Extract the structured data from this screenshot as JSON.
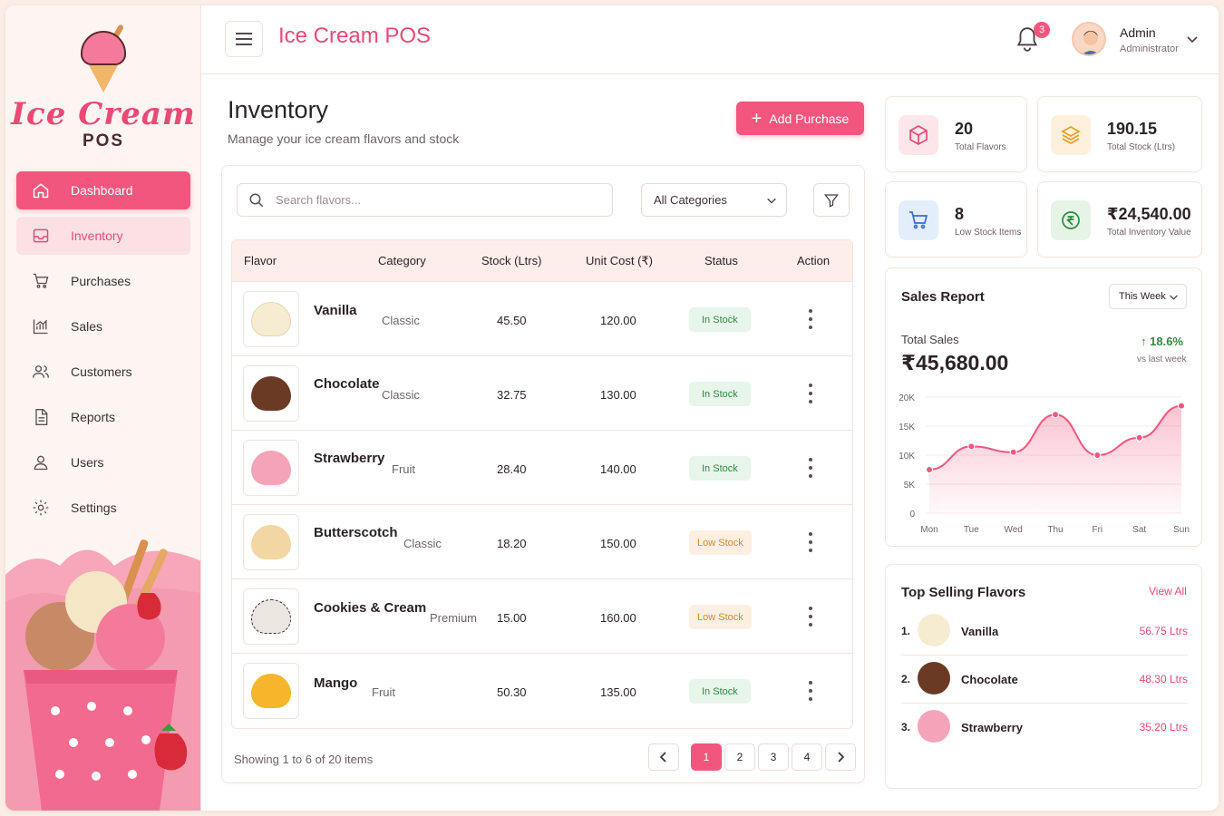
{
  "sidebar": {
    "logo_title": "Ice Cream",
    "logo_sub": "POS",
    "items": [
      {
        "label": "Dashboard",
        "icon": "home-icon"
      },
      {
        "label": "Inventory",
        "icon": "inbox-icon"
      },
      {
        "label": "Purchases",
        "icon": "cart-icon"
      },
      {
        "label": "Sales",
        "icon": "chart-icon"
      },
      {
        "label": "Customers",
        "icon": "users-icon"
      },
      {
        "label": "Reports",
        "icon": "document-icon"
      },
      {
        "label": "Users",
        "icon": "user-icon"
      },
      {
        "label": "Settings",
        "icon": "gear-icon"
      }
    ]
  },
  "header": {
    "title": "Ice Cream POS",
    "notifications": "3",
    "user_name": "Admin",
    "user_role": "Administrator"
  },
  "page": {
    "title": "Inventory",
    "subtitle": "Manage your ice cream flavors and stock",
    "add_button": "Add Purchase"
  },
  "filters": {
    "search_placeholder": "Search flavors...",
    "category": "All Categories"
  },
  "table": {
    "columns": [
      "Flavor",
      "Category",
      "Stock (Ltrs)",
      "Unit Cost (₹)",
      "Status",
      "Action"
    ],
    "rows": [
      {
        "flavor": "Vanilla",
        "category": "Classic",
        "stock": "45.50",
        "cost": "120.00",
        "status": "In Stock"
      },
      {
        "flavor": "Chocolate",
        "category": "Classic",
        "stock": "32.75",
        "cost": "130.00",
        "status": "In Stock"
      },
      {
        "flavor": "Strawberry",
        "category": "Fruit",
        "stock": "28.40",
        "cost": "140.00",
        "status": "In Stock"
      },
      {
        "flavor": "Butterscotch",
        "category": "Classic",
        "stock": "18.20",
        "cost": "150.00",
        "status": "Low Stock"
      },
      {
        "flavor": "Cookies & Cream",
        "category": "Premium",
        "stock": "15.00",
        "cost": "160.00",
        "status": "Low Stock"
      },
      {
        "flavor": "Mango",
        "category": "Fruit",
        "stock": "50.30",
        "cost": "135.00",
        "status": "In Stock"
      }
    ],
    "showing": "Showing 1 to 6 of 20 items",
    "pages": [
      "1",
      "2",
      "3",
      "4"
    ],
    "current_page": "1"
  },
  "stats": [
    {
      "value": "20",
      "label": "Total Flavors",
      "icon": "box-icon"
    },
    {
      "value": "190.15",
      "label": "Total Stock (Ltrs)",
      "icon": "layers-icon"
    },
    {
      "value": "8",
      "label": "Low Stock Items",
      "icon": "cart-icon"
    },
    {
      "value": "₹24,540.00",
      "label": "Total Inventory Value",
      "icon": "rupee-icon"
    }
  ],
  "sales_report": {
    "title": "Sales Report",
    "period": "This Week",
    "total_label": "Total Sales",
    "total_value": "₹45,680.00",
    "growth": "18.6%",
    "growth_sub": "vs last week"
  },
  "chart_data": {
    "type": "area",
    "categories": [
      "Mon",
      "Tue",
      "Wed",
      "Thu",
      "Fri",
      "Sat",
      "Sun"
    ],
    "values": [
      7500,
      11500,
      10500,
      17000,
      10000,
      13000,
      18500
    ],
    "y_ticks": [
      "0",
      "5K",
      "10K",
      "15K",
      "20K"
    ],
    "ylim": [
      0,
      20000
    ],
    "color": "#f2557d"
  },
  "top_selling": {
    "title": "Top Selling Flavors",
    "view_all": "View All",
    "items": [
      {
        "rank": "1.",
        "name": "Vanilla",
        "value": "56.75 Ltrs"
      },
      {
        "rank": "2.",
        "name": "Chocolate",
        "value": "48.30 Ltrs"
      },
      {
        "rank": "3.",
        "name": "Strawberry",
        "value": "35.20 Ltrs"
      }
    ]
  },
  "colors": {
    "accent": "#f2557d",
    "in_stock": "#2f8a3f",
    "low_stock": "#d08a2e"
  }
}
